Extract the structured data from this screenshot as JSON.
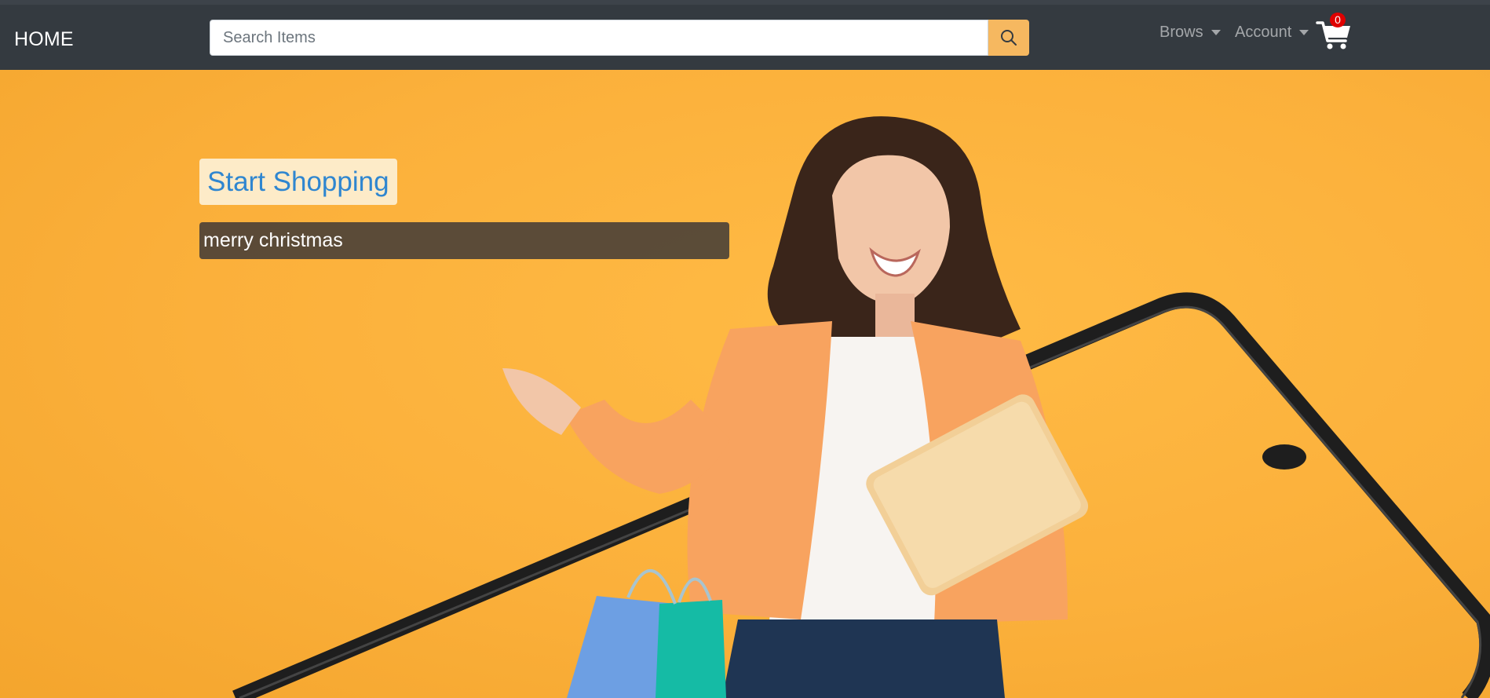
{
  "navbar": {
    "brand": "HOME",
    "search": {
      "placeholder": "Search Items",
      "value": ""
    },
    "menus": [
      {
        "label": "Brows"
      },
      {
        "label": "Account"
      }
    ],
    "cart": {
      "count": "0"
    }
  },
  "hero": {
    "cta_label": "Start Shopping",
    "tagline": "merry christmas"
  },
  "colors": {
    "navbar_bg": "#343a40",
    "hero_bg": "#fbb03b",
    "search_button": "#f6b860",
    "cta_text": "#2f86d0",
    "badge": "#e00000"
  },
  "icons": [
    "search-icon",
    "shopping-cart-icon",
    "caret-down-icon"
  ]
}
